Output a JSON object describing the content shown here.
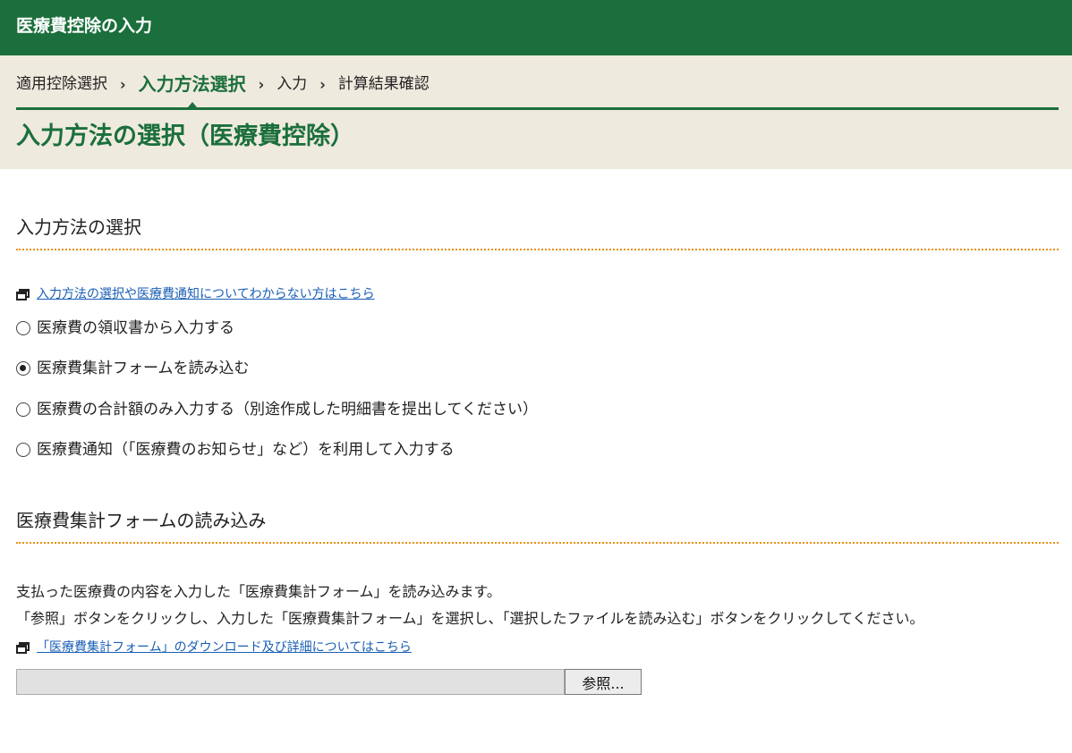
{
  "header": {
    "title": "医療費控除の入力"
  },
  "breadcrumb": {
    "items": [
      {
        "label": "適用控除選択",
        "active": false
      },
      {
        "label": "入力方法選択",
        "active": true
      },
      {
        "label": "入力",
        "active": false
      },
      {
        "label": "計算結果確認",
        "active": false
      }
    ],
    "separator": "›"
  },
  "page_title": "入力方法の選択（医療費控除）",
  "method_section": {
    "title": "入力方法の選択",
    "help_link": "入力方法の選択や医療費通知についてわからない方はこちら",
    "options": [
      {
        "label": "医療費の領収書から入力する",
        "checked": false
      },
      {
        "label": "医療費集計フォームを読み込む",
        "checked": true
      },
      {
        "label": "医療費の合計額のみ入力する（別途作成した明細書を提出してください）",
        "checked": false
      },
      {
        "label": "医療費通知（「医療費のお知らせ」など）を利用して入力する",
        "checked": false
      }
    ]
  },
  "form_section": {
    "title": "医療費集計フォームの読み込み",
    "description_line1": "支払った医療費の内容を入力した「医療費集計フォーム」を読み込みます。",
    "description_line2": "「参照」ボタンをクリックし、入力した「医療費集計フォーム」を選択し、「選択したファイルを読み込む」ボタンをクリックしてください。",
    "download_link": "「医療費集計フォーム」のダウンロード及び詳細についてはこちら",
    "file_value": "",
    "browse_label": "参照..."
  },
  "colors": {
    "brand_green": "#1b6f3c",
    "band_bg": "#efeade",
    "dotted_orange": "#e8900f",
    "link_blue": "#1a5fb4"
  },
  "icons": {
    "link_icon": "new-window-icon",
    "separator_icon": "chevron-right-icon"
  }
}
